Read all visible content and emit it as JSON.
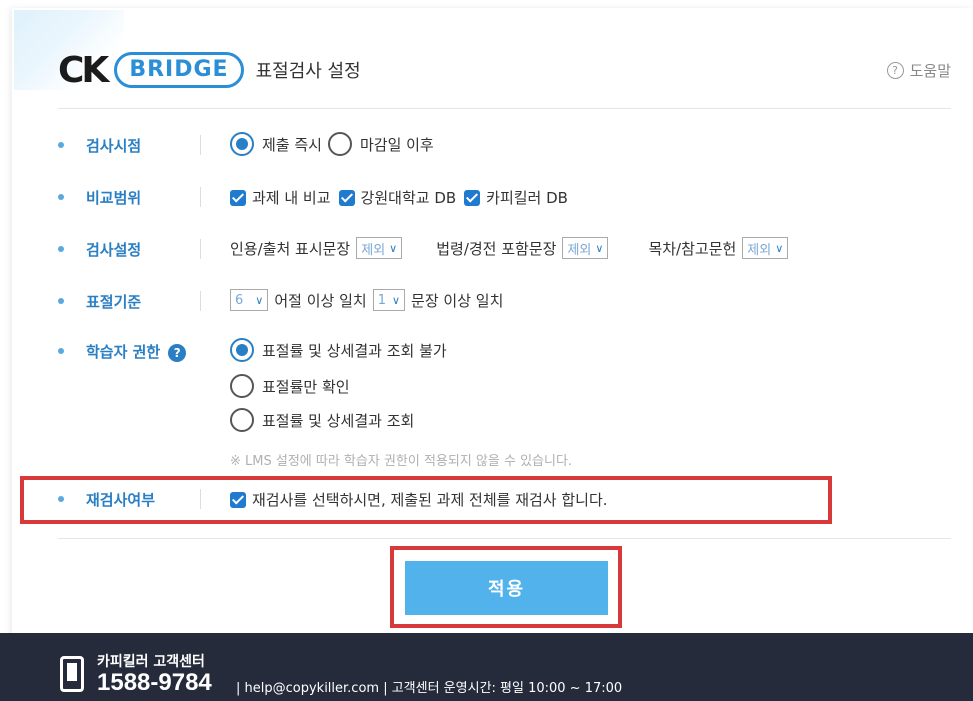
{
  "header": {
    "logo_ck": "CK",
    "logo_bridge": "BRIDGE",
    "title": "표절검사 설정",
    "help_label": "도움말",
    "help_icon": "question-circle-icon"
  },
  "settings": {
    "inspection_time": {
      "label": "검사시점",
      "options": [
        {
          "label": "제출 즉시",
          "selected": true
        },
        {
          "label": "마감일 이후",
          "selected": false
        }
      ]
    },
    "comparison_scope": {
      "label": "비교범위",
      "options": [
        {
          "label": "과제 내 비교",
          "checked": true
        },
        {
          "label": "강원대학교 DB",
          "checked": true
        },
        {
          "label": "카피킬러 DB",
          "checked": true
        }
      ]
    },
    "inspection_settings": {
      "label": "검사설정",
      "items": [
        {
          "label": "인용/출처 표시문장",
          "value": "제외"
        },
        {
          "label": "법령/경전 포함문장",
          "value": "제외"
        },
        {
          "label": "목차/참고문헌",
          "value": "제외"
        }
      ]
    },
    "plagiarism_criteria": {
      "label": "표절기준",
      "word_count": "6",
      "word_text": "어절 이상 일치",
      "sentence_count": "1",
      "sentence_text": "문장 이상 일치"
    },
    "learner_permission": {
      "label": "학습자 권한",
      "options": [
        {
          "label": "표절률 및 상세결과 조회 불가",
          "selected": true
        },
        {
          "label": "표절률만 확인",
          "selected": false
        },
        {
          "label": "표절률 및 상세결과 조회",
          "selected": false
        }
      ],
      "note": "※ LMS 설정에 따라 학습자 권한이 적용되지 않을 수 있습니다."
    },
    "recheck": {
      "label": "재검사여부",
      "option": "재검사를 선택하시면, 제출된 과제 전체를 재검사 합니다.",
      "checked": true
    }
  },
  "apply_button": "적용",
  "footer": {
    "cs_label": "카피킬러 고객센터",
    "phone": "1588-9784",
    "info": "| help@copykiller.com | 고객센터 운영시간: 평일 10:00 ~ 17:00"
  },
  "colors": {
    "accent": "#2a7fc4",
    "button": "#52b2ec",
    "highlight": "#d8393a",
    "footer_bg": "#252b3b"
  }
}
